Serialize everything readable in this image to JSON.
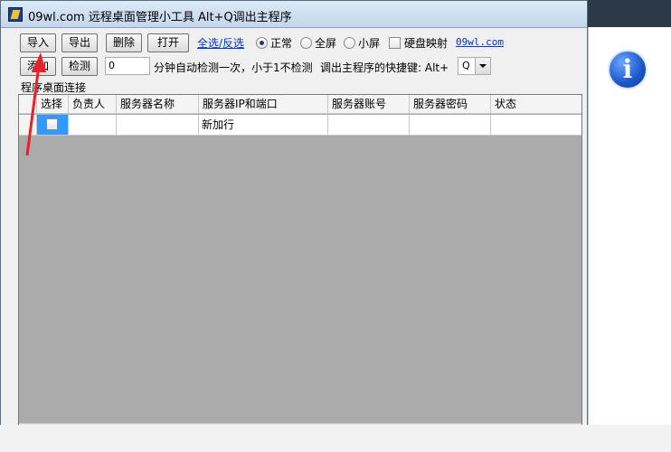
{
  "window": {
    "title": "09wl.com 远程桌面管理小工具 Alt+Q调出主程序"
  },
  "toolbar": {
    "import_label": "导入",
    "export_label": "导出",
    "delete_label": "删除",
    "open_label": "打开",
    "select_all_label": "全选/反选",
    "mode_normal_label": "正常",
    "mode_full_label": "全屏",
    "mode_small_label": "小屏",
    "mode_selected": "正常",
    "disk_map_label": "硬盘映射",
    "disk_map_checked": false,
    "site_link": "09wl.com",
    "add_label": "添加",
    "check_label": "检测",
    "interval_value": "0",
    "interval_desc": "分钟自动检测一次，小于1不检测",
    "hotkey_label": "调出主程序的快捷键: Alt+",
    "hotkey_value": "Q"
  },
  "group": {
    "label": "程序桌面连接"
  },
  "table": {
    "columns": [
      "选择",
      "负责人",
      "服务器名称",
      "服务器IP和端口",
      "服务器账号",
      "服务器密码",
      "状态"
    ],
    "rows": [
      {
        "select": false,
        "owner": "",
        "name": "",
        "ip": "新加行",
        "account": "",
        "password": "",
        "status": ""
      }
    ]
  },
  "scrollbar": {
    "grip": "||||"
  },
  "background": {
    "info_icon": "i",
    "accent": "#1b56c8"
  }
}
